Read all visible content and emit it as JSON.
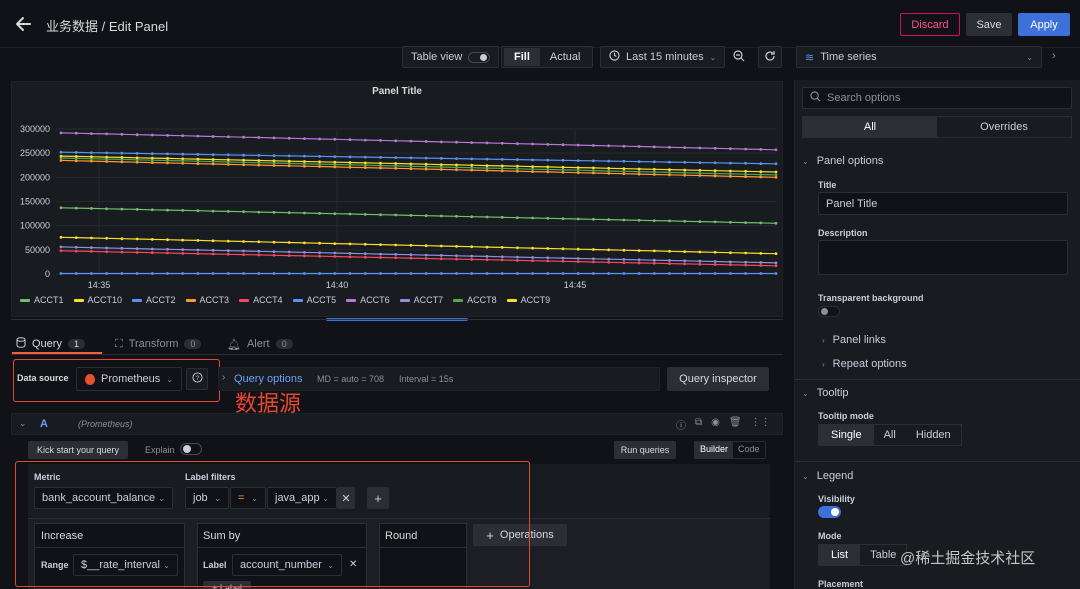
{
  "header": {
    "title": "业务数据 / Edit Panel",
    "discard_label": "Discard",
    "save_label": "Save",
    "apply_label": "Apply"
  },
  "toolbar": {
    "table_view_label": "Table view",
    "fill_label": "Fill",
    "actual_label": "Actual",
    "time_range_label": "Last 15 minutes",
    "viz_label": "Time series"
  },
  "chart_data": {
    "type": "line",
    "title": "Panel Title",
    "xlabel": "",
    "ylabel": "",
    "x_ticks": [
      "14:35",
      "14:40",
      "14:45"
    ],
    "y_ticks": [
      "300000",
      "250000",
      "200000",
      "150000",
      "100000",
      "50000",
      "0"
    ],
    "ylim": [
      0,
      300000
    ],
    "series": [
      {
        "name": "ACCT1",
        "color": "#73bf69",
        "start": 137000,
        "end": 105000
      },
      {
        "name": "ACCT10",
        "color": "#fade2a",
        "start": 76000,
        "end": 42000
      },
      {
        "name": "ACCT2",
        "color": "#5794f2",
        "start": 252000,
        "end": 228000
      },
      {
        "name": "ACCT3",
        "color": "#ff9830",
        "start": 235000,
        "end": 200000
      },
      {
        "name": "ACCT4",
        "color": "#f2495c",
        "start": 48000,
        "end": 17000
      },
      {
        "name": "ACCT5",
        "color": "#5794f2",
        "start": 1000,
        "end": 1000
      },
      {
        "name": "ACCT6",
        "color": "#b877d9",
        "start": 292000,
        "end": 257000
      },
      {
        "name": "ACCT7",
        "color": "#8f8fdf",
        "start": 56000,
        "end": 23000
      },
      {
        "name": "ACCT8",
        "color": "#56a64b",
        "start": 240000,
        "end": 205000
      },
      {
        "name": "ACCT9",
        "color": "#fade2a",
        "start": 244000,
        "end": 211000
      }
    ]
  },
  "tabs": {
    "query_label": "Query",
    "query_count": "1",
    "transform_label": "Transform",
    "transform_count": "0",
    "alert_label": "Alert",
    "alert_count": "0"
  },
  "datasource": {
    "label": "Data source",
    "value": "Prometheus",
    "query_options_label": "Query options",
    "query_options_detail": "MD = auto = 708",
    "interval_detail": "Interval = 15s",
    "inspector_label": "Query inspector",
    "annotation": "数据源"
  },
  "query": {
    "ref": "A",
    "source": "(Prometheus)",
    "kick_start_label": "Kick start your query",
    "explain_label": "Explain",
    "run_label": "Run queries",
    "builder_label": "Builder",
    "code_label": "Code",
    "metric_label": "Metric",
    "metric_value": "bank_account_balance",
    "label_filters_label": "Label filters",
    "filter_key": "job",
    "filter_op": "=",
    "filter_value": "java_app",
    "op1_title": "Increase",
    "range_label": "Range",
    "range_value": "$__rate_interval",
    "op2_title": "Sum by",
    "label_label": "Label",
    "label_value": "account_number",
    "add_label": "+ Label",
    "op3_title": "Round",
    "operations_label": "Operations"
  },
  "options": {
    "search_placeholder": "Search options",
    "all_tab": "All",
    "overrides_tab": "Overrides",
    "panel_options_title": "Panel options",
    "title_label": "Title",
    "title_value": "Panel Title",
    "description_label": "Description",
    "transparent_label": "Transparent background",
    "panel_links_label": "Panel links",
    "repeat_options_label": "Repeat options",
    "tooltip_title": "Tooltip",
    "tooltip_mode_label": "Tooltip mode",
    "tooltip_single": "Single",
    "tooltip_all": "All",
    "tooltip_hidden": "Hidden",
    "legend_title": "Legend",
    "visibility_label": "Visibility",
    "mode_label": "Mode",
    "mode_list": "List",
    "mode_table": "Table",
    "placement_label": "Placement"
  },
  "watermark": "@稀土掘金技术社区"
}
